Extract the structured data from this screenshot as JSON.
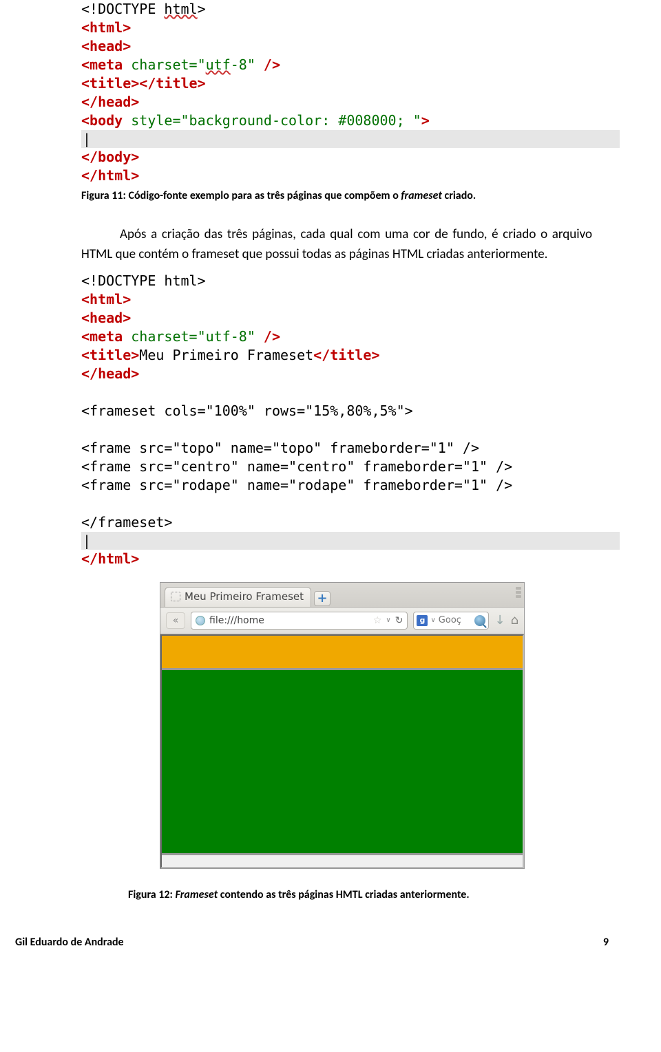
{
  "code1": {
    "l1_a": "<!DOCTYPE ",
    "l1_b_wave": "html",
    "l1_c": ">",
    "l2": "<html>",
    "l3": "<head>",
    "l4_a": "<meta ",
    "l4_attr": "charset=",
    "l4_val": "\"",
    "l4_val_wave": "utf",
    "l4_val2": "-8\"",
    "l4_end": " />",
    "l5_a": "<title></title>",
    "l6": "</head>",
    "l7_a": "<body ",
    "l7_attr": "style=",
    "l7_val": "\"background-color: #008000; \"",
    "l7_end": ">",
    "cursor": "|",
    "l8": "</body>",
    "l9": "</html>"
  },
  "caption1_a": "Figura 11: Código-fonte exemplo para as três páginas que compõem o ",
  "caption1_b": "frameset",
  "caption1_c": " criado.",
  "para1": "Após a criação das três páginas, cada qual com uma cor de fundo, é criado o arquivo HTML que contém o frameset que possui todas as páginas HTML criadas anteriormente.",
  "code2": {
    "l1": "<!DOCTYPE html>",
    "l2": "<html>",
    "l3": "<head>",
    "l4_a": "<meta ",
    "l4_attr": "charset=",
    "l4_val": "\"utf-8\"",
    "l4_end": " />",
    "l5_a": "<title>",
    "l5_b": "Meu Primeiro Frameset",
    "l5_c": "</title>",
    "l6": "</head>",
    "blank": " ",
    "l7_a": "<frameset ",
    "l7_attr1": "cols=",
    "l7_val1": "\"100%\"",
    "l7_attr2": " rows=",
    "l7_val2": "\"15%,80%,5%\"",
    "l7_end": ">",
    "l8_a": "<frame ",
    "l8_attrs": "src=\"topo\" name=\"topo\" frameborder=\"1\"",
    "l8_end": " />",
    "l9_a": "<frame ",
    "l9_attrs": "src=\"centro\" name=\"centro\" frameborder=\"1\"",
    "l9_end": " />",
    "l10_a": "<frame ",
    "l10_attrs": "src=\"rodape\" name=\"rodape\" frameborder=\"1\"",
    "l10_end": " />",
    "l11": "</frameset>",
    "cursor": "|",
    "l12": "</html>"
  },
  "browser": {
    "tab_title": "Meu Primeiro Frameset",
    "newtab": "+",
    "back": "«",
    "url": "file:///home",
    "star": "☆",
    "caret": "∨",
    "reload": "↻",
    "g_badge": "g",
    "search_placeholder": "Gooç",
    "download": "↓",
    "home": "⌂"
  },
  "caption2_a": "Figura 12: ",
  "caption2_b": "Frameset",
  "caption2_c": " contendo as três páginas HMTL criadas anteriormente.",
  "footer_author": "Gil Eduardo de Andrade",
  "footer_page": "9"
}
